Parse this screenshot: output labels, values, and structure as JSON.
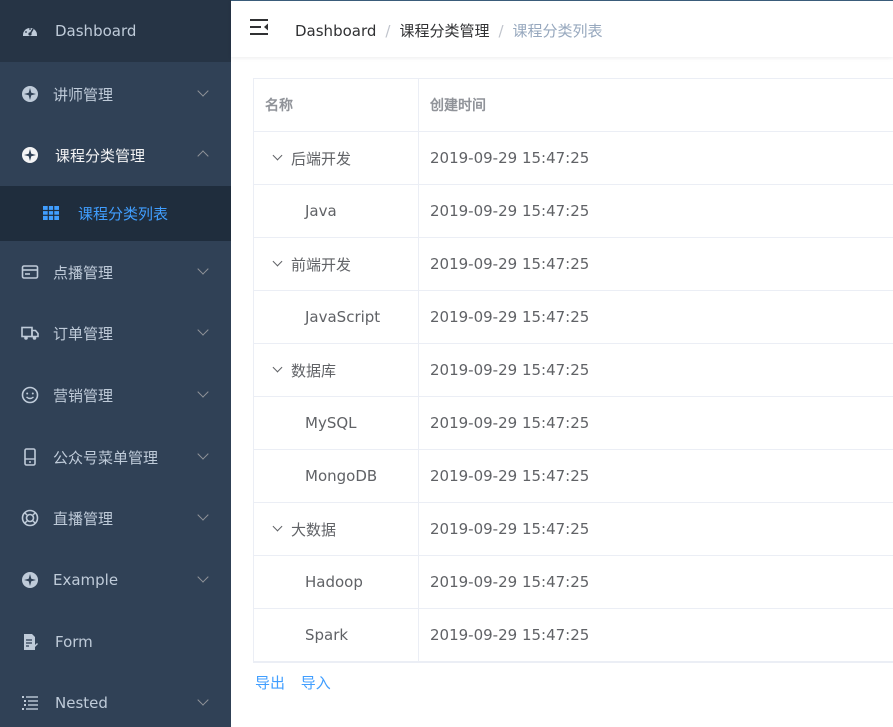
{
  "sidebar": {
    "items": [
      {
        "label": "Dashboard",
        "icon": "dashboard-icon"
      },
      {
        "label": "讲师管理",
        "icon": "example-icon"
      },
      {
        "label": "课程分类管理",
        "icon": "example-icon"
      },
      {
        "label": "点播管理",
        "icon": "card-icon"
      },
      {
        "label": "订单管理",
        "icon": "truck-icon"
      },
      {
        "label": "营销管理",
        "icon": "face-icon"
      },
      {
        "label": "公众号菜单管理",
        "icon": "phone-icon"
      },
      {
        "label": "直播管理",
        "icon": "lifebuoy-icon"
      },
      {
        "label": "Example",
        "icon": "example-icon"
      },
      {
        "label": "Form",
        "icon": "form-icon"
      },
      {
        "label": "Nested",
        "icon": "nested-icon"
      }
    ],
    "active_sub": {
      "label": "课程分类列表",
      "icon": "table-icon"
    }
  },
  "breadcrumb": [
    "Dashboard",
    "课程分类管理",
    "课程分类列表"
  ],
  "table": {
    "headers": [
      "名称",
      "创建时间"
    ],
    "rows": [
      {
        "name": "后端开发",
        "time": "2019-09-29 15:47:25"
      },
      {
        "name": "Java",
        "time": "2019-09-29 15:47:25"
      },
      {
        "name": "前端开发",
        "time": "2019-09-29 15:47:25"
      },
      {
        "name": "JavaScript",
        "time": "2019-09-29 15:47:25"
      },
      {
        "name": "数据库",
        "time": "2019-09-29 15:47:25"
      },
      {
        "name": "MySQL",
        "time": "2019-09-29 15:47:25"
      },
      {
        "name": "MongoDB",
        "time": "2019-09-29 15:47:25"
      },
      {
        "name": "大数据",
        "time": "2019-09-29 15:47:25"
      },
      {
        "name": "Hadoop",
        "time": "2019-09-29 15:47:25"
      },
      {
        "name": "Spark",
        "time": "2019-09-29 15:47:25"
      }
    ]
  },
  "actions": {
    "export": "导出",
    "import": "导入"
  },
  "colors": {
    "sidebar_bg": "#304156",
    "active": "#409eff",
    "submenu_bg": "#1f2d3d"
  }
}
